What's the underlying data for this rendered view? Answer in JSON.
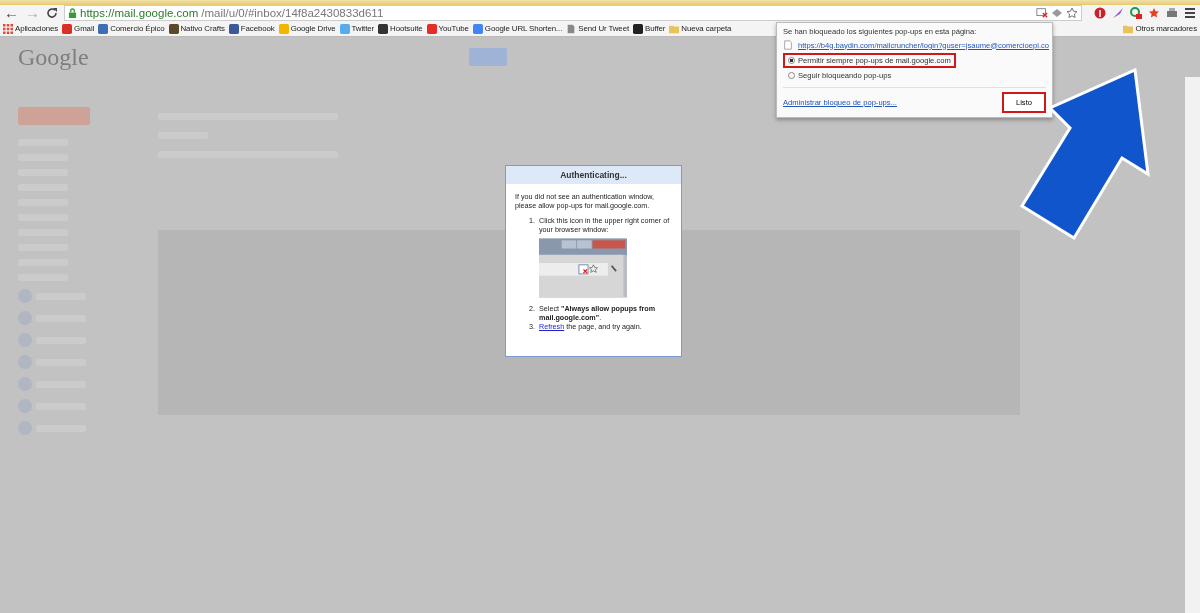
{
  "browser": {
    "back": "←",
    "forward": "→",
    "url_host": "https://mail.google.com",
    "url_path": "/mail/u/0/#inbox/14f8a2430833d611"
  },
  "bookmarks": [
    {
      "label": "Aplicaciones",
      "kind": "apps",
      "color": "#e04a3a"
    },
    {
      "label": "Gmail",
      "kind": "site",
      "color": "#d93025"
    },
    {
      "label": "Comercio Épico",
      "kind": "site",
      "color": "#3b6fb6"
    },
    {
      "label": "Nativo Crafts",
      "kind": "site",
      "color": "#5a4a2a"
    },
    {
      "label": "Facebook",
      "kind": "site",
      "color": "#3b5998"
    },
    {
      "label": "Google Drive",
      "kind": "site",
      "color": "#f4b400"
    },
    {
      "label": "Twitter",
      "kind": "site",
      "color": "#55acee"
    },
    {
      "label": "Hootsuite",
      "kind": "site",
      "color": "#333333"
    },
    {
      "label": "YouTube",
      "kind": "site",
      "color": "#e52d27"
    },
    {
      "label": "Google URL Shorten...",
      "kind": "site",
      "color": "#4285f4"
    },
    {
      "label": "Send Ur Tweet",
      "kind": "page",
      "color": "#888888"
    },
    {
      "label": "Buffer",
      "kind": "site",
      "color": "#222222"
    },
    {
      "label": "Nueva carpeta",
      "kind": "folder",
      "color": "#e8c35a"
    }
  ],
  "other_bookmarks": "Otros marcadores",
  "gmail_logo": "Google",
  "popup_blocker": {
    "message": "Se han bloqueado los siguientes pop-ups en esta página:",
    "blocked_url": "https://b4g.baydin.com/mailcruncher/login?guser=jsaume@comercioepi.co",
    "options": [
      {
        "label": "Permitir siempre pop-ups de mail.google.com",
        "selected": true,
        "highlighted": true
      },
      {
        "label": "Seguir bloqueando pop-ups",
        "selected": false,
        "highlighted": false
      }
    ],
    "manage_link": "Administrar bloqueo de pop-ups...",
    "done_button": {
      "label": "Listo",
      "highlighted": true
    }
  },
  "auth_dialog": {
    "title": "Authenticating...",
    "intro": "If you did not see an authentication window, please allow pop-ups for mail.google.com.",
    "steps": [
      {
        "number": "1.",
        "kind": "image",
        "text": "Click this icon in the upper right corner of your browser window:"
      },
      {
        "number": "2.",
        "kind": "text",
        "text": "Select **\"Always allow popups from mail.google.com\"**."
      },
      {
        "number": "3.",
        "kind": "link",
        "link": "Refresh",
        "text": " the page, and try again."
      }
    ]
  }
}
